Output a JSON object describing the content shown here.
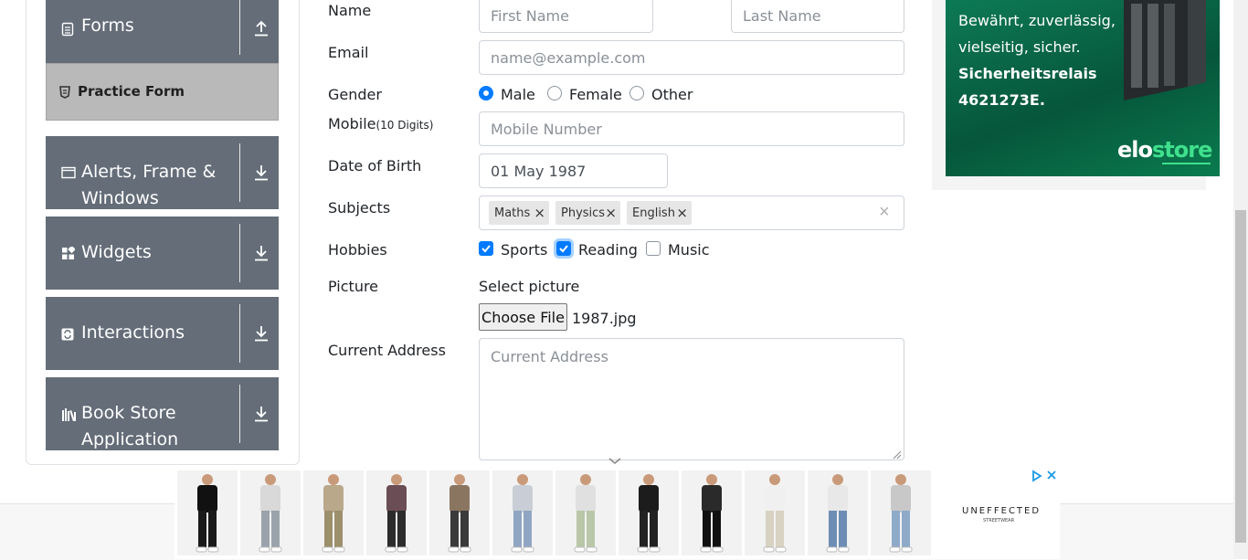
{
  "sidebar": {
    "groups": [
      {
        "label": "Forms",
        "icon": "document-icon",
        "state": "expanded"
      },
      {
        "label": "Alerts, Frame & Windows",
        "label_line1": "Alerts, Frame &",
        "label_line2": "Windows",
        "icon": "window-icon",
        "state": "collapsed"
      },
      {
        "label": "Widgets",
        "icon": "widgets-icon",
        "state": "collapsed"
      },
      {
        "label": "Interactions",
        "icon": "interactions-icon",
        "state": "collapsed"
      },
      {
        "label": "Book Store Application",
        "label_line1": "Book Store",
        "label_line2": "Application",
        "icon": "books-icon",
        "state": "collapsed"
      }
    ],
    "active_item": {
      "label": "Practice Form",
      "icon": "shield-icon"
    }
  },
  "form": {
    "name": {
      "label": "Name",
      "first_placeholder": "First Name",
      "last_placeholder": "Last Name"
    },
    "email": {
      "label": "Email",
      "placeholder": "name@example.com"
    },
    "gender": {
      "label": "Gender",
      "options": [
        "Male",
        "Female",
        "Other"
      ],
      "selected": "Male"
    },
    "mobile": {
      "label": "Mobile",
      "label_hint": "(10 Digits)",
      "placeholder": "Mobile Number"
    },
    "dob": {
      "label": "Date of Birth",
      "value": "01 May 1987"
    },
    "subjects": {
      "label": "Subjects",
      "chips": [
        "Maths",
        "Physics",
        "English"
      ],
      "clear": "×"
    },
    "hobbies": {
      "label": "Hobbies",
      "options": [
        "Sports",
        "Reading",
        "Music"
      ],
      "checked": [
        "Sports",
        "Reading"
      ]
    },
    "picture": {
      "label": "Picture",
      "caption": "Select picture",
      "button": "Choose File",
      "filename": "1987.jpg"
    },
    "address": {
      "label": "Current Address",
      "placeholder": "Current Address"
    }
  },
  "ad_top": {
    "line1": "Bewährt, zuverlässig,",
    "line2": "vielseitig, sicher.",
    "line3": "Sicherheitsrelais",
    "line4": "4621273E.",
    "logo_a": "elo",
    "logo_b": "store",
    "accent": "#3fe08d",
    "background": "#0a6b48"
  },
  "ad_bottom": {
    "brand": "UNEFFECTED",
    "brand_sub": "STREETWEAR",
    "thumbnails": 12
  },
  "colors": {
    "sidebar_group": "#646d78",
    "active_item": "#b9b9b9",
    "primary": "#007bff"
  }
}
